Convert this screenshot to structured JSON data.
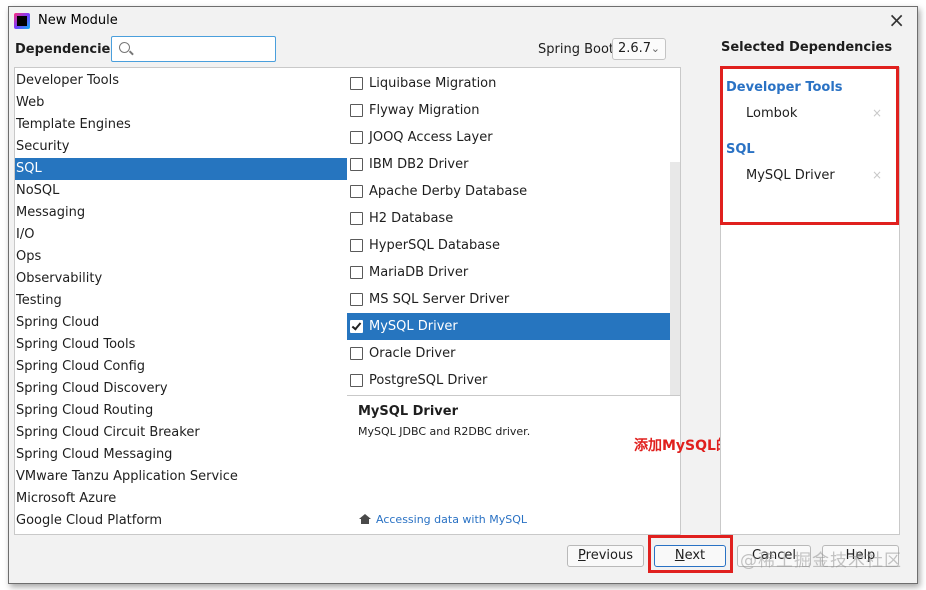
{
  "window": {
    "title": "New Module",
    "close_glyph": "×"
  },
  "header": {
    "dependencies_label": "Dependencies",
    "search": {
      "value": "",
      "placeholder": ""
    },
    "spring_boot_label": "Spring Boot",
    "spring_boot_version": "2.6.7",
    "selected_title": "Selected Dependencies"
  },
  "categories": [
    {
      "label": "Developer Tools"
    },
    {
      "label": "Web"
    },
    {
      "label": "Template Engines"
    },
    {
      "label": "Security"
    },
    {
      "label": "SQL",
      "selected": true
    },
    {
      "label": "NoSQL"
    },
    {
      "label": "Messaging"
    },
    {
      "label": "I/O"
    },
    {
      "label": "Ops"
    },
    {
      "label": "Observability"
    },
    {
      "label": "Testing"
    },
    {
      "label": "Spring Cloud"
    },
    {
      "label": "Spring Cloud Tools"
    },
    {
      "label": "Spring Cloud Config"
    },
    {
      "label": "Spring Cloud Discovery"
    },
    {
      "label": "Spring Cloud Routing"
    },
    {
      "label": "Spring Cloud Circuit Breaker"
    },
    {
      "label": "Spring Cloud Messaging"
    },
    {
      "label": "VMware Tanzu Application Service"
    },
    {
      "label": "Microsoft Azure"
    },
    {
      "label": "Google Cloud Platform"
    }
  ],
  "dependencies": [
    {
      "label": "Liquibase Migration",
      "checked": false
    },
    {
      "label": "Flyway Migration",
      "checked": false
    },
    {
      "label": "JOOQ Access Layer",
      "checked": false
    },
    {
      "label": "IBM DB2 Driver",
      "checked": false
    },
    {
      "label": "Apache Derby Database",
      "checked": false
    },
    {
      "label": "H2 Database",
      "checked": false
    },
    {
      "label": "HyperSQL Database",
      "checked": false
    },
    {
      "label": "MariaDB Driver",
      "checked": false
    },
    {
      "label": "MS SQL Server Driver",
      "checked": false
    },
    {
      "label": "MySQL Driver",
      "checked": true,
      "selected": true
    },
    {
      "label": "Oracle Driver",
      "checked": false
    },
    {
      "label": "PostgreSQL Driver",
      "checked": false
    }
  ],
  "description": {
    "title": "MySQL Driver",
    "text": "MySQL JDBC and R2DBC driver.",
    "link": "Accessing data with MySQL"
  },
  "selected": {
    "groups": [
      {
        "name": "Developer Tools",
        "items": [
          "Lombok"
        ]
      },
      {
        "name": "SQL",
        "items": [
          "MySQL Driver"
        ]
      }
    ],
    "remove_glyph": "×"
  },
  "annotation": "添加MySQL的驱动和Lombok",
  "buttons": {
    "previous_mnemonic": "P",
    "previous_rest": "revious",
    "next_mnemonic": "N",
    "next_rest": "ext",
    "cancel": "Cancel",
    "help": "Help"
  },
  "watermark": "@稀土掘金技术社区",
  "colors": {
    "selection": "#2675bf",
    "link": "#2a72c4",
    "annotation_red": "#e0201e"
  }
}
